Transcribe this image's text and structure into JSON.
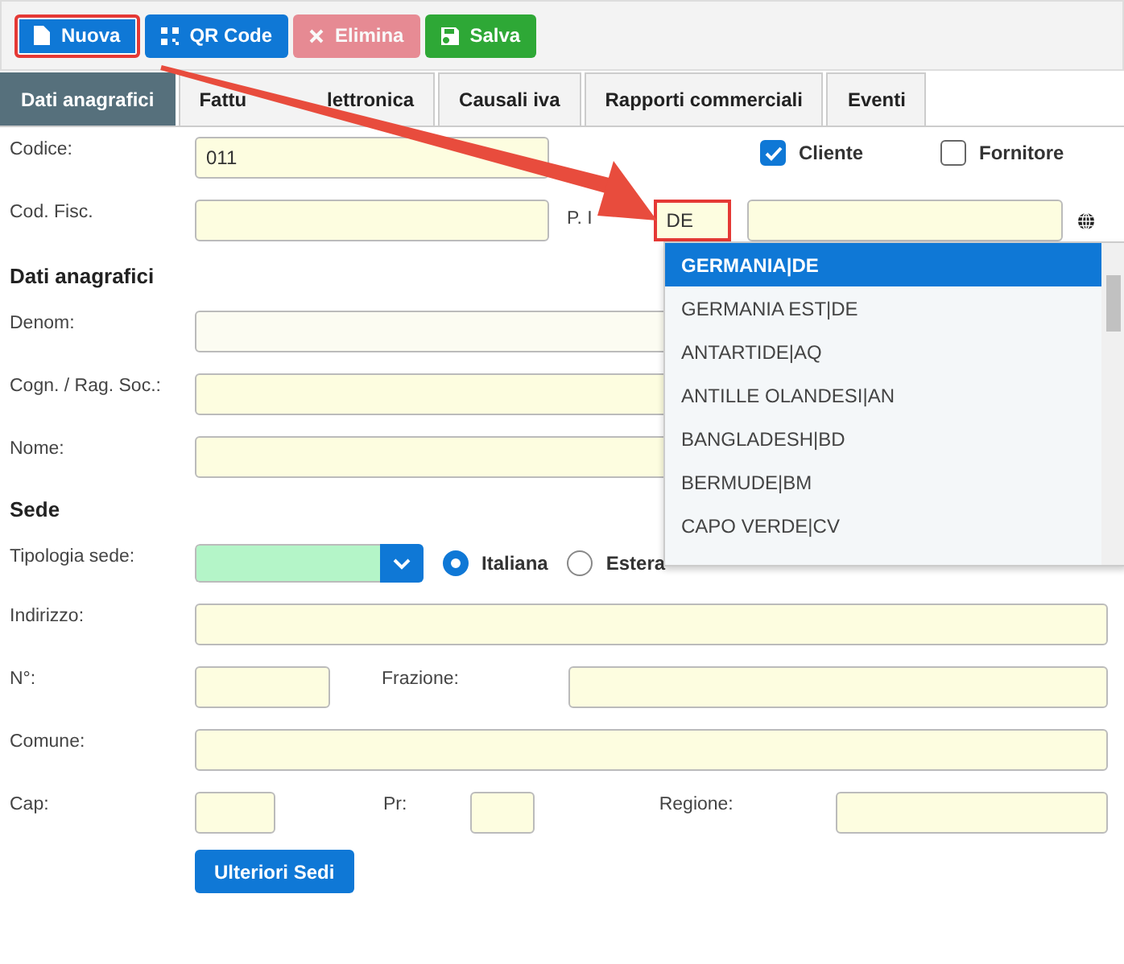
{
  "toolbar": {
    "buttons": [
      {
        "label": "Nuova",
        "kind": "new",
        "highlighted": true,
        "disabled": false
      },
      {
        "label": "QR Code",
        "kind": "qr",
        "highlighted": false,
        "disabled": false
      },
      {
        "label": "Elimina",
        "kind": "delete",
        "highlighted": false,
        "disabled": true
      },
      {
        "label": "Salva",
        "kind": "save",
        "highlighted": false,
        "disabled": false
      }
    ]
  },
  "tabs": [
    {
      "label": "Dati anagrafici",
      "selected": true
    },
    {
      "label_parts": [
        "Fattu",
        "lettronica"
      ],
      "selected": false
    },
    {
      "label": "Causali iva",
      "selected": false
    },
    {
      "label": "Rapporti commerciali",
      "selected": false
    },
    {
      "label": "Eventi",
      "selected": false
    }
  ],
  "codice": {
    "label": "Codice:",
    "value": "011"
  },
  "roles": [
    {
      "label": "Cliente",
      "checked": true
    },
    {
      "label": "Fornitore",
      "checked": false
    }
  ],
  "cod_fisc": {
    "label": "Cod. Fisc."
  },
  "p_iva": {
    "label": "P. I",
    "country": "DE",
    "highlighted": true
  },
  "country_dropdown": {
    "items": [
      {
        "label": "GERMANIA|DE",
        "selected": true
      },
      {
        "label": "GERMANIA EST|DE",
        "selected": false
      },
      {
        "label": "ANTARTIDE|AQ",
        "selected": false
      },
      {
        "label": "ANTILLE OLANDESI|AN",
        "selected": false
      },
      {
        "label": "BANGLADESH|BD",
        "selected": false
      },
      {
        "label": "BERMUDE|BM",
        "selected": false
      },
      {
        "label": "CAPO VERDE|CV",
        "selected": false
      }
    ]
  },
  "anagrafica": {
    "title": "Dati anagrafici",
    "fields": [
      {
        "label": "Denom:",
        "disabled": true
      },
      {
        "label": "Cogn. / Rag. Soc.:",
        "disabled": false
      },
      {
        "label": "Nome:",
        "disabled": false
      }
    ]
  },
  "sede": {
    "title": "Sede",
    "tipologia": {
      "label": "Tipologia sede:"
    },
    "location": [
      {
        "label": "Italiana",
        "selected": true
      },
      {
        "label": "Estera",
        "selected": false
      }
    ],
    "indirizzo": {
      "label": "Indirizzo:"
    },
    "numero": {
      "label": "N°:"
    },
    "frazione": {
      "label": "Frazione:"
    },
    "comune": {
      "label": "Comune:"
    },
    "cap": {
      "label": "Cap:"
    },
    "pr": {
      "label": "Pr:"
    },
    "regione": {
      "label": "Regione:"
    },
    "button": "Ulteriori Sedi"
  }
}
